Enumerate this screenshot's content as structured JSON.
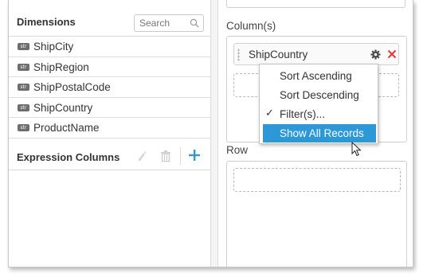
{
  "dimensions": {
    "title": "Dimensions",
    "search_placeholder": "Search",
    "items": [
      {
        "type": "str",
        "label": "ShipCity"
      },
      {
        "type": "str",
        "label": "ShipRegion"
      },
      {
        "type": "str",
        "label": "ShipPostalCode"
      },
      {
        "type": "str",
        "label": "ShipCountry"
      },
      {
        "type": "str",
        "label": "ProductName"
      }
    ]
  },
  "expression_columns": {
    "title": "Expression Columns",
    "icons": [
      "edit-icon",
      "delete-icon",
      "add-icon"
    ],
    "add_color": "#2c98d8"
  },
  "columns": {
    "label": "Column(s)",
    "chip_label": "ShipCountry",
    "chip_icons": [
      "settings-gear-icon",
      "remove-close-icon"
    ],
    "close_color": "#e53935"
  },
  "rows": {
    "label": "Row"
  },
  "context_menu": {
    "items": [
      {
        "label": "Sort Ascending",
        "checked": false,
        "active": false
      },
      {
        "label": "Sort Descending",
        "checked": false,
        "active": false
      },
      {
        "label": "Filter(s)...",
        "checked": true,
        "active": false
      },
      {
        "label": "Show All Records",
        "checked": false,
        "active": true
      }
    ],
    "check_glyph": "✓",
    "active_color": "#2c98d8"
  }
}
